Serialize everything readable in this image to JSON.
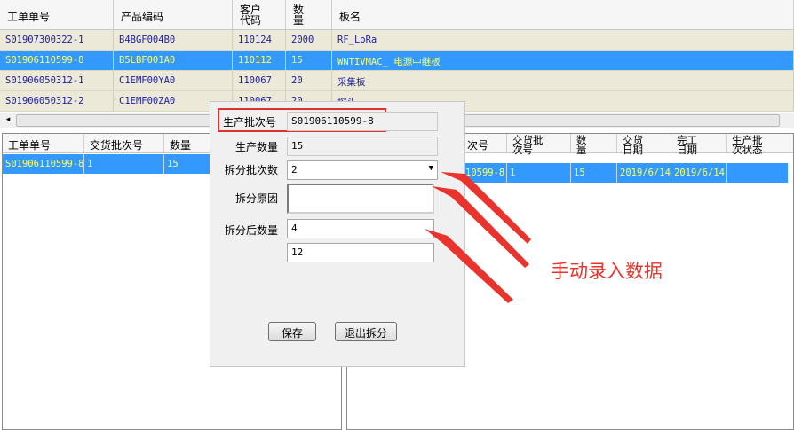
{
  "top_grid": {
    "headers": [
      "工单单号",
      "产品编码",
      "客户\n代码",
      "数\n量",
      "板名"
    ],
    "rows": [
      [
        "S01907300322-1",
        "B4BGF004B0",
        "110124",
        "2000",
        "RF_LoRa"
      ],
      [
        "S01906110599-8",
        "B5LBF001A0",
        "110112",
        "15",
        "WNTIVMAC_ 电源中继板"
      ],
      [
        "S01906050312-1",
        "C1EMF00YA0",
        "110067",
        "20",
        "采集板"
      ],
      [
        "S01906050312-2",
        "C1EMF00ZA0",
        "110067",
        "20",
        "探头"
      ]
    ],
    "selected_row": 1,
    "scroll_thumb": "III"
  },
  "left_grid": {
    "headers": [
      "工单单号",
      "交货批次号",
      "数量"
    ],
    "row": [
      "S01906110599-8",
      "1",
      "15"
    ]
  },
  "right_grid": {
    "headers": [
      "次号",
      "交货批\n次号",
      "数\n量",
      "交货\n日期",
      "完工\n日期",
      "生产批\n次状态"
    ],
    "row": [
      "10599-8",
      "1",
      "15",
      "2019/6/14",
      "2019/6/14",
      ""
    ]
  },
  "dialog": {
    "batch_label": "生产批次号",
    "batch_value": "S01906110599-8",
    "qty_label": "生产数量",
    "qty_value": "15",
    "split_count_label": "拆分批次数",
    "split_count_value": "2",
    "reason_label": "拆分原因",
    "reason_value": "",
    "after_qty_label": "拆分后数量",
    "after_qty_values": [
      "4",
      "12"
    ],
    "save_label": "保存",
    "exit_label": "退出拆分"
  },
  "annotation": {
    "text": "手动录入数据",
    "color": "#e8342c"
  },
  "colors": {
    "row_bg": "#ece9d8",
    "selected_bg": "#3399ff",
    "cell_text": "#2020a0",
    "selected_text": "#ffff60"
  }
}
